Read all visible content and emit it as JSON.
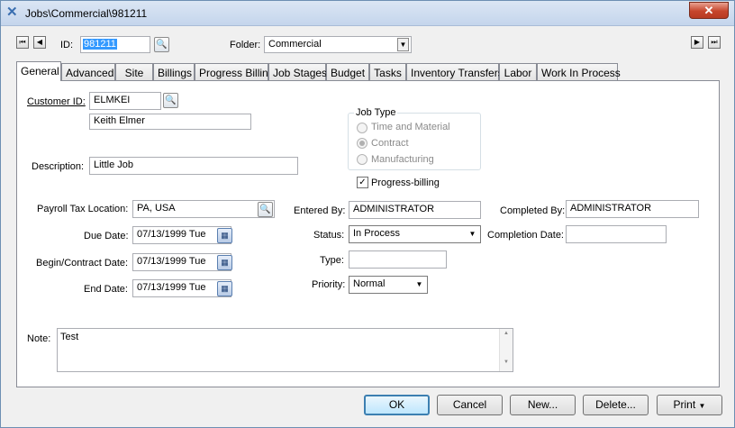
{
  "window": {
    "title": "Jobs\\Commercial\\981211",
    "close": "✕"
  },
  "header": {
    "id_label": "ID:",
    "id_value": "981211",
    "folder_label": "Folder:",
    "folder_value": "Commercial"
  },
  "tabs": [
    "General",
    "Advanced",
    "Site",
    "Billings",
    "Progress Billing",
    "Job Stages",
    "Budget",
    "Tasks",
    "Inventory Transfers",
    "Labor",
    "Work In Process"
  ],
  "general": {
    "customer_id_label": "Customer ID:",
    "customer_id": "ELMKEI",
    "customer_name": "Keith Elmer",
    "description_label": "Description:",
    "description": "Little Job",
    "job_type_label": "Job Type",
    "job_types": [
      "Time and Material",
      "Contract",
      "Manufacturing"
    ],
    "job_type_selected": "Contract",
    "progress_billing_label": "Progress-billing",
    "progress_billing_checked": true,
    "payroll_tax_label": "Payroll Tax Location:",
    "payroll_tax": "PA, USA",
    "due_date_label": "Due Date:",
    "due_date": "07/13/1999 Tue",
    "begin_date_label": "Begin/Contract Date:",
    "begin_date": "07/13/1999 Tue",
    "end_date_label": "End Date:",
    "end_date": "07/13/1999 Tue",
    "entered_by_label": "Entered By:",
    "entered_by": "ADMINISTRATOR",
    "status_label": "Status:",
    "status": "In Process",
    "type_label": "Type:",
    "type": "",
    "priority_label": "Priority:",
    "priority": "Normal",
    "completed_by_label": "Completed By:",
    "completed_by": "ADMINISTRATOR",
    "completion_date_label": "Completion Date:",
    "completion_date": "",
    "note_label": "Note:",
    "note": "Test"
  },
  "buttons": {
    "ok": "OK",
    "cancel": "Cancel",
    "new": "New...",
    "delete": "Delete...",
    "print": "Print"
  }
}
